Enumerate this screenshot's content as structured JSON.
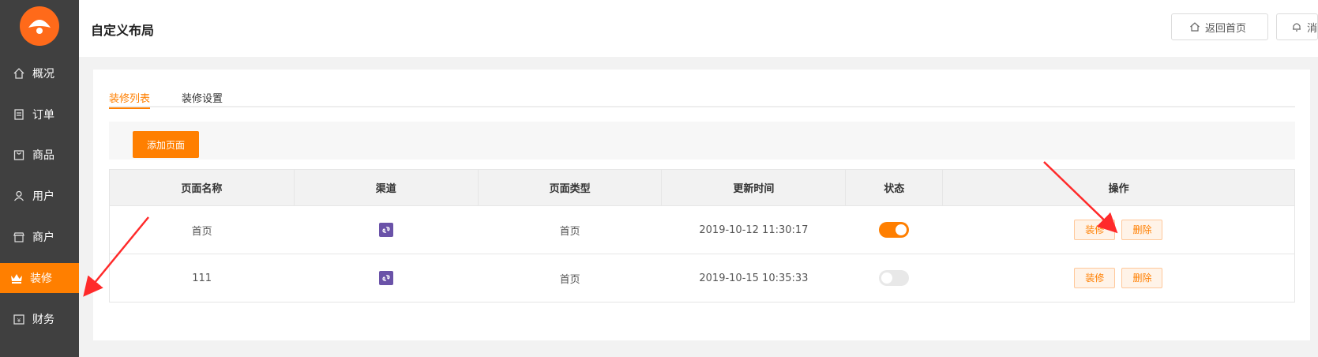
{
  "sidebar": {
    "items": [
      {
        "label": "概况",
        "icon": "home-icon"
      },
      {
        "label": "订单",
        "icon": "order-icon"
      },
      {
        "label": "商品",
        "icon": "bag-icon"
      },
      {
        "label": "用户",
        "icon": "user-icon"
      },
      {
        "label": "商户",
        "icon": "store-icon"
      },
      {
        "label": "装修",
        "icon": "crown-icon",
        "active": true
      },
      {
        "label": "财务",
        "icon": "wallet-icon"
      }
    ]
  },
  "header": {
    "title": "自定义布局",
    "home_label": "返回首页",
    "msg_label": "消"
  },
  "tabs": [
    {
      "label": "装修列表",
      "active": true
    },
    {
      "label": "装修设置",
      "active": false
    }
  ],
  "toolbar": {
    "add_label": "添加页面"
  },
  "table": {
    "headers": [
      "页面名称",
      "渠道",
      "页面类型",
      "更新时间",
      "状态",
      "操作"
    ],
    "rows": [
      {
        "name": "首页",
        "channel": "mini-program-icon",
        "type": "首页",
        "updated": "2019-10-12 11:30:17",
        "status": "on",
        "decorate": "装修",
        "delete": "删除"
      },
      {
        "name": "111",
        "channel": "mini-program-icon",
        "type": "首页",
        "updated": "2019-10-15 10:35:33",
        "status": "off",
        "decorate": "装修",
        "delete": "删除"
      }
    ]
  },
  "colors": {
    "accent": "#ff7f00",
    "sidebar_bg": "#404040",
    "arrow": "#ff2a2a"
  }
}
